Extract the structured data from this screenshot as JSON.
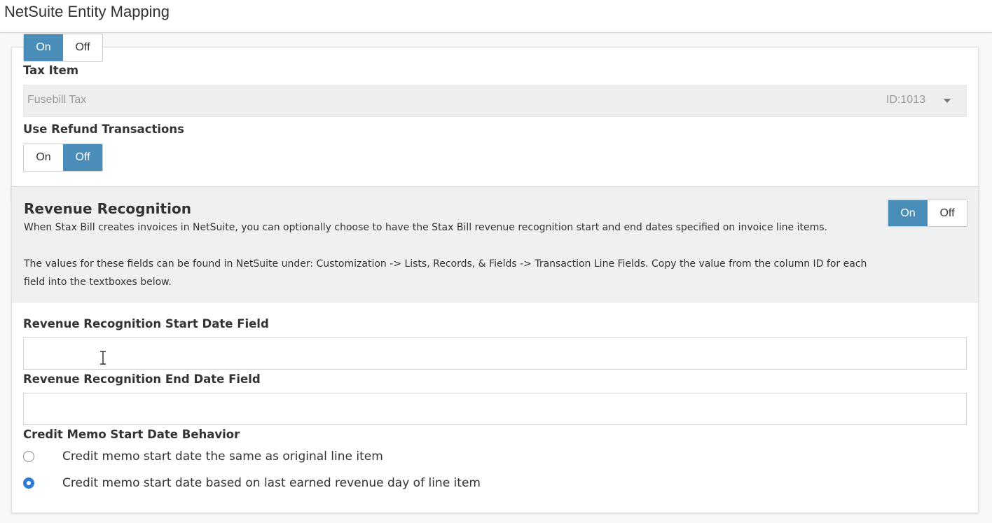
{
  "header": {
    "title": "NetSuite Entity Mapping"
  },
  "tax_section": {
    "prev_toggle": {
      "on": "On",
      "off": "Off",
      "selected": "On"
    },
    "tax_item": {
      "label": "Tax Item",
      "value": "Fusebill Tax",
      "id": "ID:1013"
    },
    "refund": {
      "label": "Use Refund Transactions",
      "toggle": {
        "on": "On",
        "off": "Off",
        "selected": "Off"
      }
    }
  },
  "revenue_section": {
    "title": "Revenue Recognition",
    "toggle": {
      "on": "On",
      "off": "Off",
      "selected": "On"
    },
    "description": [
      "When Stax Bill creates invoices in NetSuite, you can optionally choose to have the Stax Bill revenue recognition start and end dates specified on invoice line items.",
      "The values for these fields can be found in NetSuite under: Customization -> Lists, Records, & Fields -> Transaction Line Fields. Copy the value from the column ID for each field into the textboxes below."
    ],
    "start_date_field": {
      "label": "Revenue Recognition Start Date Field",
      "value": ""
    },
    "end_date_field": {
      "label": "Revenue Recognition End Date Field",
      "value": ""
    },
    "credit_memo": {
      "label": "Credit Memo Start Date Behavior",
      "options": [
        {
          "label": "Credit memo start date the same as original line item",
          "checked": false
        },
        {
          "label": "Credit memo start date based on last earned revenue day of line item",
          "checked": true
        }
      ]
    }
  },
  "colors": {
    "toggle_active": "#4a8db8",
    "radio_checked": "#2f7cd6",
    "section_header_bg": "#eff0f2"
  }
}
